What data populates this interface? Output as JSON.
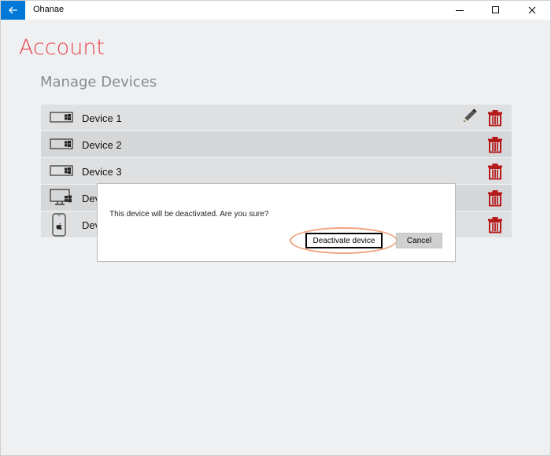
{
  "window": {
    "title": "Ohanae",
    "controls": [
      "minimize-icon",
      "maximize-icon",
      "close-icon"
    ]
  },
  "page": {
    "title": "Account",
    "section_title": "Manage Devices"
  },
  "devices": [
    {
      "name": "Device 1",
      "icon": "windows-laptop-icon",
      "editable": true
    },
    {
      "name": "Device 2",
      "icon": "windows-laptop-icon",
      "editable": false
    },
    {
      "name": "Device 3",
      "icon": "windows-laptop-icon",
      "editable": false
    },
    {
      "name": "Dev",
      "icon": "windows-desktop-icon",
      "editable": false
    },
    {
      "name": "Dev",
      "icon": "apple-phone-icon",
      "editable": false
    }
  ],
  "dialog": {
    "message": "This device will be deactivated. Are you sure?",
    "confirm_label": "Deactivate device",
    "cancel_label": "Cancel"
  },
  "colors": {
    "accent": "#0078d7",
    "title": "#e8424f",
    "delete": "#b41a1a",
    "highlight": "#f0a27c"
  }
}
